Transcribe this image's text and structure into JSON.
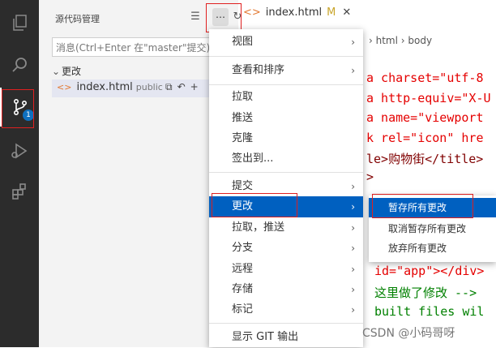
{
  "activity": {
    "badge": "1"
  },
  "sidebar": {
    "title": "源代码管理",
    "tools": [
      "☰",
      "✓",
      "↻"
    ],
    "more": "⋯",
    "message_placeholder": "消息(Ctrl+Enter 在\"master\"提交)",
    "changes_label": "更改",
    "file": {
      "name": "index.html",
      "tag": "public"
    },
    "row_actions": [
      "⧉",
      "↶",
      "+"
    ]
  },
  "tab": {
    "name": "index.html",
    "status": "M"
  },
  "breadcrumbs": [
    "html",
    "body"
  ],
  "code_lines": [
    "a charset=\"utf-8",
    "a http-equiv=\"X-U",
    "a name=\"viewport",
    "k rel=\"icon\" hre",
    "le>购物街</title>",
    ">",
    "id=\"app\"></div>",
    "这里做了修改 -->",
    "built files wil"
  ],
  "menu": {
    "items": [
      {
        "label": "视图",
        "submenu": true
      },
      {
        "label": "查看和排序",
        "submenu": true
      },
      {
        "label": "拉取",
        "submenu": false
      },
      {
        "label": "推送",
        "submenu": false
      },
      {
        "label": "克隆",
        "submenu": false
      },
      {
        "label": "签出到...",
        "submenu": false
      },
      {
        "label": "提交",
        "submenu": true
      },
      {
        "label": "更改",
        "submenu": true
      },
      {
        "label": "拉取，推送",
        "submenu": true
      },
      {
        "label": "分支",
        "submenu": true
      },
      {
        "label": "远程",
        "submenu": true
      },
      {
        "label": "存储",
        "submenu": true
      },
      {
        "label": "标记",
        "submenu": true
      },
      {
        "label": "显示 GIT 输出",
        "submenu": false
      }
    ]
  },
  "submenu": {
    "items": [
      "暂存所有更改",
      "取消暂存所有更改",
      "放弃所有更改"
    ]
  },
  "watermark": "CSDN @小码哥呀",
  "colors": {
    "accent": "#0060c0",
    "highlight": "#e02020"
  }
}
